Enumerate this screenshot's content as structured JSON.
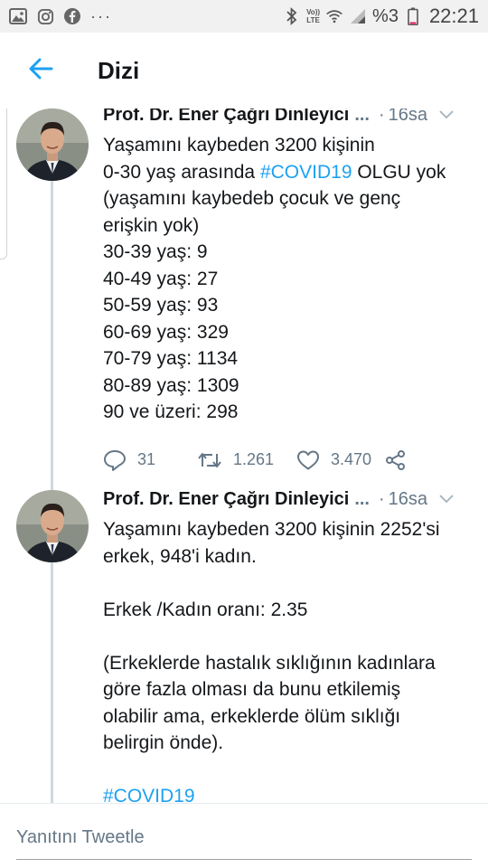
{
  "status_bar": {
    "left_icons": [
      "image-icon",
      "instagram-icon",
      "facebook-icon"
    ],
    "more": "···",
    "right_icons": [
      "bluetooth-icon",
      "volte-icon",
      "wifi-icon",
      "signal-icon"
    ],
    "volte_top": "Vo))",
    "volte_bottom": "LTE",
    "battery_percent": "%3",
    "time": "22:21"
  },
  "header": {
    "title": "Dizi",
    "accent_color": "#1da1f2"
  },
  "tweets": [
    {
      "author": "Prof. Dr. Ener Çağrı Dinleyici",
      "ellipsis": "...",
      "dot": "·",
      "time": "16sa",
      "lines": [
        "Yaşamını kaybeden 3200 kişinin",
        "0-30 yaş arasında",
        "(yaşamını kaybedeb çocuk ve genç",
        "erişkin yok)",
        "30-39 yaş: 9",
        "40-49 yaş: 27",
        "50-59 yaş: 93",
        "60-69 yaş: 329",
        "70-79 yaş: 1134",
        "80-89 yaş: 1309",
        "90 ve üzeri: 298"
      ],
      "hashtag": "#COVID19",
      "line2_suffix": " OLGU yok",
      "replies": "31",
      "retweets": "1.261",
      "likes": "3.470"
    },
    {
      "author": "Prof. Dr. Ener Çağrı Dinleyici",
      "ellipsis": "...",
      "dot": "·",
      "time": "16sa",
      "lines": [
        "Yaşamını kaybeden 3200 kişinin 2252'si",
        "erkek, 948'i kadın.",
        "",
        "Erkek /Kadın oranı: 2.35",
        "",
        "(Erkeklerde hastalık sıklığının kadınlara",
        "göre fazla olması da bunu etkilemiş",
        "olabilir ama, erkeklerde ölüm sıklığı",
        "belirgin önde).",
        ""
      ],
      "hashtag": "#COVID19"
    }
  ],
  "reply": {
    "placeholder": "Yanıtını Tweetle"
  }
}
